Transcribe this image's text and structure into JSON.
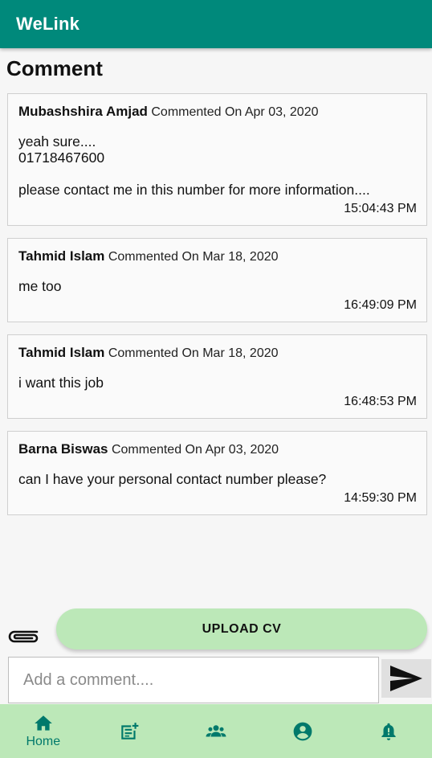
{
  "app": {
    "title": "WeLink"
  },
  "page": {
    "title": "Comment"
  },
  "comments": [
    {
      "author": "Mubashshira Amjad",
      "meta": "Commented On Apr 03, 2020",
      "text": "yeah sure....\n01718467600\n\nplease contact me in this number for more information....",
      "time": "15:04:43 PM"
    },
    {
      "author": "Tahmid Islam",
      "meta": "Commented On Mar 18, 2020",
      "text": "me too",
      "time": "16:49:09 PM"
    },
    {
      "author": "Tahmid Islam",
      "meta": "Commented On Mar 18, 2020",
      "text": "i want this job",
      "time": "16:48:53 PM"
    },
    {
      "author": "Barna Biswas",
      "meta": "Commented On Apr 03, 2020",
      "text": "can I have your personal contact number please?",
      "time": "14:59:30 PM"
    }
  ],
  "actions": {
    "attach_icon": "paperclip-icon",
    "upload_label": "UPLOAD CV",
    "comment_placeholder": "Add a comment....",
    "comment_value": "",
    "send_icon": "send-icon"
  },
  "bottom_nav": {
    "items": [
      {
        "icon": "home-icon",
        "label": "Home",
        "active": true
      },
      {
        "icon": "post-add-icon",
        "label": "",
        "active": false
      },
      {
        "icon": "people-icon",
        "label": "",
        "active": false
      },
      {
        "icon": "account-icon",
        "label": "",
        "active": false
      },
      {
        "icon": "notification-icon",
        "label": "",
        "active": false
      }
    ]
  },
  "colors": {
    "primary": "#00897b",
    "accent_green": "#bce8b8",
    "nav_icon": "#00796b"
  }
}
